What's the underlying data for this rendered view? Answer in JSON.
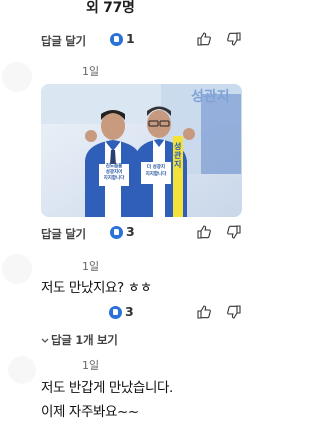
{
  "header": {
    "more_text": "외 77명"
  },
  "comments": [
    {
      "reply_label": "답글 달기",
      "like_count": "1"
    },
    {
      "time": "1일",
      "reply_label": "답글 달기",
      "like_count": "3"
    },
    {
      "time": "1일",
      "text": "저도 만났지요? ㅎㅎ",
      "like_count": "3",
      "view_replies": "답글 1개 보기"
    },
    {
      "time": "1일",
      "text_line1": "저도 반갑게 만났습니다.",
      "text_line2": "이제 자주봐요~~"
    }
  ],
  "photo": {
    "banner_text": "성관지",
    "badge_left_line1": "김도읍을",
    "badge_left_line2": "성광지이",
    "badge_left_line3": "지지합니다",
    "badge_right_line1": "더 성광지",
    "badge_right_line2": "지지합니다",
    "sash_right": "성관지"
  },
  "colors": {
    "accent": "#2a72d9",
    "vest_blue": "#2f5fb8"
  }
}
